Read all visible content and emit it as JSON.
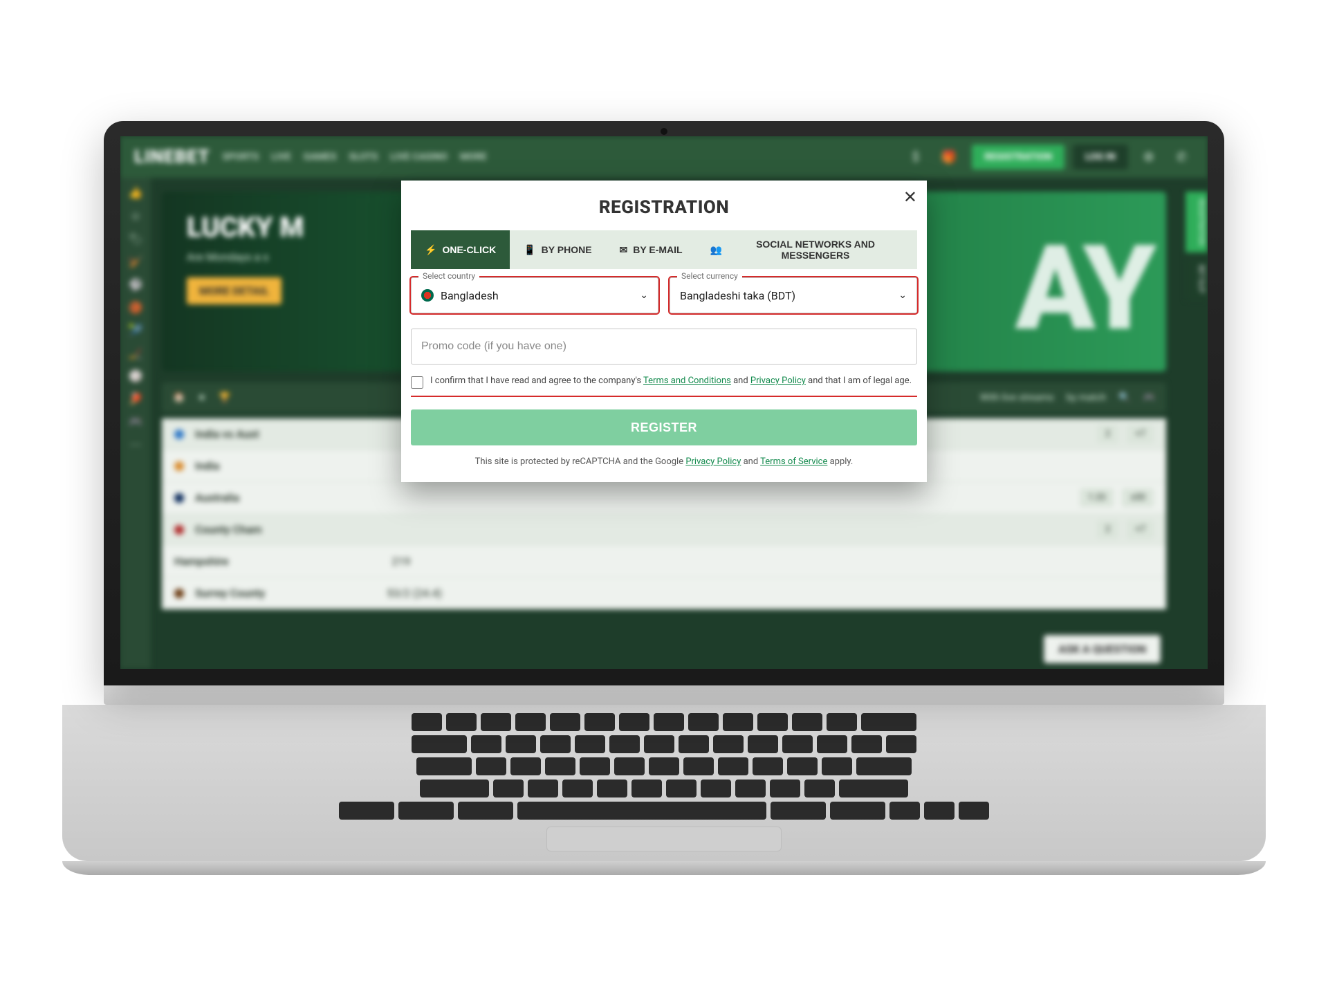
{
  "brand": "LINEBET",
  "nav": {
    "sports": "SPORTS",
    "live": "LIVE",
    "games": "GAMES",
    "slots": "SLOTS",
    "live_casino": "LIVE CASINO",
    "more": "MORE"
  },
  "cta": {
    "registration": "REGISTRATION",
    "login": "LOG IN"
  },
  "promo": {
    "title": "LUCKY M",
    "sub": "Are Mondays a s",
    "badge": "MORE DETAIL",
    "bigword": "AY"
  },
  "right_rail": {
    "registration": "REGISTRATION",
    "bet_slip": "BET SLIP"
  },
  "toolbar2": {
    "streams": "With live streams",
    "search": "by match"
  },
  "list": {
    "r0": "India vs Aust",
    "r1": "India",
    "r2": "Australia",
    "r3": "County Cham",
    "r4": "Hampshire",
    "r4_score": "219",
    "r5": "Surrey County",
    "r5_score": "53/2 (24.4)",
    "chip_2": "2",
    "chip_p7": "+7",
    "chip_1_33": "1.33",
    "chip_pm": "±00"
  },
  "ask": "ASK A QUESTION",
  "modal": {
    "title": "REGISTRATION",
    "tabs": {
      "one_click": "ONE-CLICK",
      "by_phone": "BY PHONE",
      "by_email": "BY E-MAIL",
      "social": "SOCIAL NETWORKS AND MESSENGERS"
    },
    "country_label": "Select country",
    "country_value": "Bangladesh",
    "currency_label": "Select currency",
    "currency_value": "Bangladeshi taka (BDT)",
    "promo_placeholder": "Promo code (if you have one)",
    "consent_pre": "I confirm that I have read and agree to the company's ",
    "terms": "Terms and Conditions",
    "and": " and ",
    "privacy": "Privacy Policy",
    "consent_post": " and that I am of legal age.",
    "register": "REGISTER",
    "recaptcha_pre": "This site is protected by reCAPTCHA and the Google ",
    "recaptcha_pp": "Privacy Policy",
    "recaptcha_and": " and ",
    "recaptcha_tos": "Terms of Service",
    "recaptcha_post": " apply."
  }
}
